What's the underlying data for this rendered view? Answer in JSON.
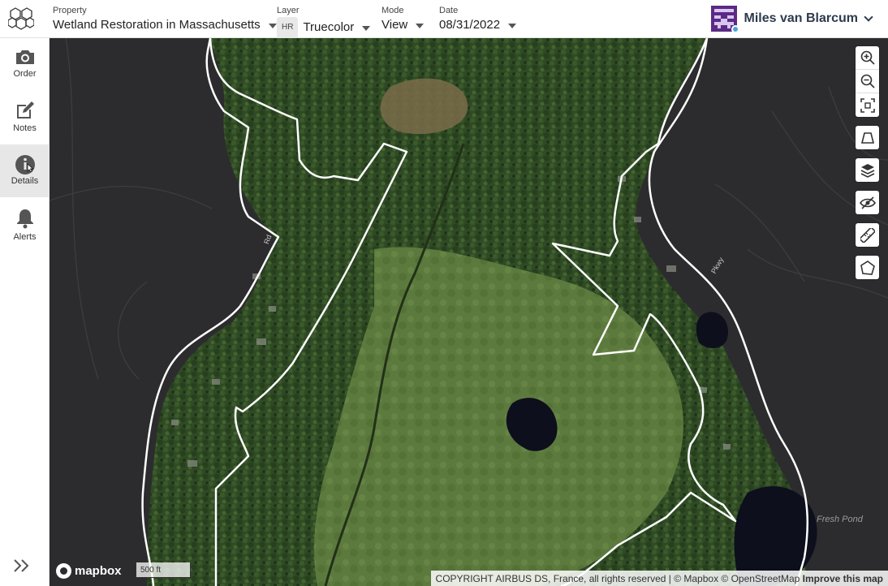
{
  "header": {
    "property": {
      "label": "Property",
      "value": "Wetland Restoration in Massachusetts"
    },
    "layer": {
      "label": "Layer",
      "badge": "HR",
      "value": "Truecolor"
    },
    "mode": {
      "label": "Mode",
      "value": "View"
    },
    "date": {
      "label": "Date",
      "value": "08/31/2022"
    },
    "user": {
      "name": "Miles van Blarcum",
      "status_color": "#4aa3df"
    }
  },
  "sidebar": {
    "items": [
      {
        "label": "Order",
        "icon": "camera-icon"
      },
      {
        "label": "Notes",
        "icon": "edit-icon"
      },
      {
        "label": "Details",
        "icon": "info-icon",
        "active": true
      },
      {
        "label": "Alerts",
        "icon": "bell-icon"
      }
    ],
    "expand_icon": "double-chevron-right-icon"
  },
  "map": {
    "controls": [
      "zoom-in-icon",
      "zoom-out-icon",
      "fit-bounds-icon",
      "perspective-icon",
      "layers-icon",
      "hide-icon",
      "ruler-icon",
      "polygon-draw-icon"
    ],
    "logo": "mapbox",
    "scale": "500 ft",
    "pond_label": "Fresh Pond",
    "road_labels": [
      "Rd",
      "Pkwy"
    ],
    "attribution": {
      "text": "COPYRIGHT AIRBUS DS, France, all rights reserved | © Mapbox © OpenStreetMap",
      "improve": "Improve this map"
    },
    "colors": {
      "boundary": "#ffffff",
      "base_dark": "#2c2c2e",
      "forest": "#2f4a25",
      "wetland": "#5f7a3f"
    }
  }
}
